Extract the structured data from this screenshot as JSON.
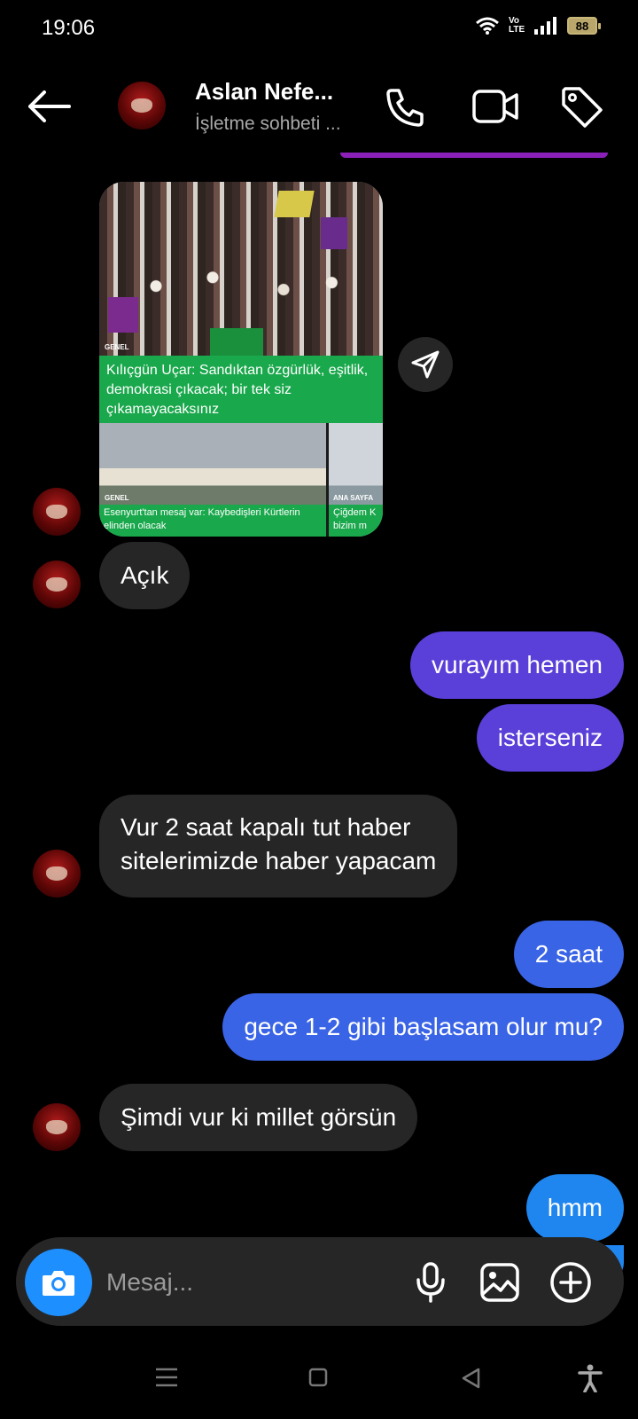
{
  "status_bar": {
    "time": "19:06",
    "network_label": "Vo LTE",
    "battery": "88"
  },
  "header": {
    "name": "Aslan Nefe...",
    "subtitle": "İşletme sohbeti ...",
    "icons": [
      "back-arrow-icon",
      "phone-icon",
      "video-camera-icon",
      "tag-icon"
    ]
  },
  "media_card": {
    "top_tag": "GENEL",
    "headline": "Kılıçgün Uçar: Sandıktan özgürlük, eşitlik, demokrasi çıkacak; bir tek siz çıkamayacaksınız",
    "left_tag": "GENEL",
    "left_headline": "Esenyurt'tan mesaj var: Kaybedişleri Kürtlerin elinden olacak",
    "right_tag": "ANA SAYFA",
    "right_headline": "Çiğdem K bizim m"
  },
  "messages": [
    {
      "id": "m1",
      "direction": "in",
      "text": "Açık"
    },
    {
      "id": "m2",
      "direction": "out",
      "text": "vurayım hemen"
    },
    {
      "id": "m3",
      "direction": "out",
      "text": "isterseniz"
    },
    {
      "id": "m4",
      "direction": "in",
      "text": "Vur 2 saat kapalı tut haber sitelerimizde haber yapacam",
      "lines": [
        "Vur 2 saat kapalı tut haber",
        "sitelerimizde haber yapacam"
      ]
    },
    {
      "id": "m5",
      "direction": "out",
      "text": "2 saat"
    },
    {
      "id": "m6",
      "direction": "out",
      "text": "gece 1-2 gibi başlasam olur mu?"
    },
    {
      "id": "m7",
      "direction": "in",
      "text": "Şimdi vur ki millet görsün"
    },
    {
      "id": "m8",
      "direction": "out",
      "text": "hmm"
    }
  ],
  "composer": {
    "placeholder": "Mesaj...",
    "icons": [
      "camera-icon",
      "microphone-icon",
      "gallery-icon",
      "add-icon"
    ]
  },
  "colors": {
    "background": "#000000",
    "incoming_bubble": "#262626",
    "outgoing_purple": "#5a3fd9",
    "outgoing_blue": "#3a64e6",
    "outgoing_cyan": "#1f86ef",
    "news_green": "#1aa84c",
    "camera_button": "#1d8fff"
  }
}
